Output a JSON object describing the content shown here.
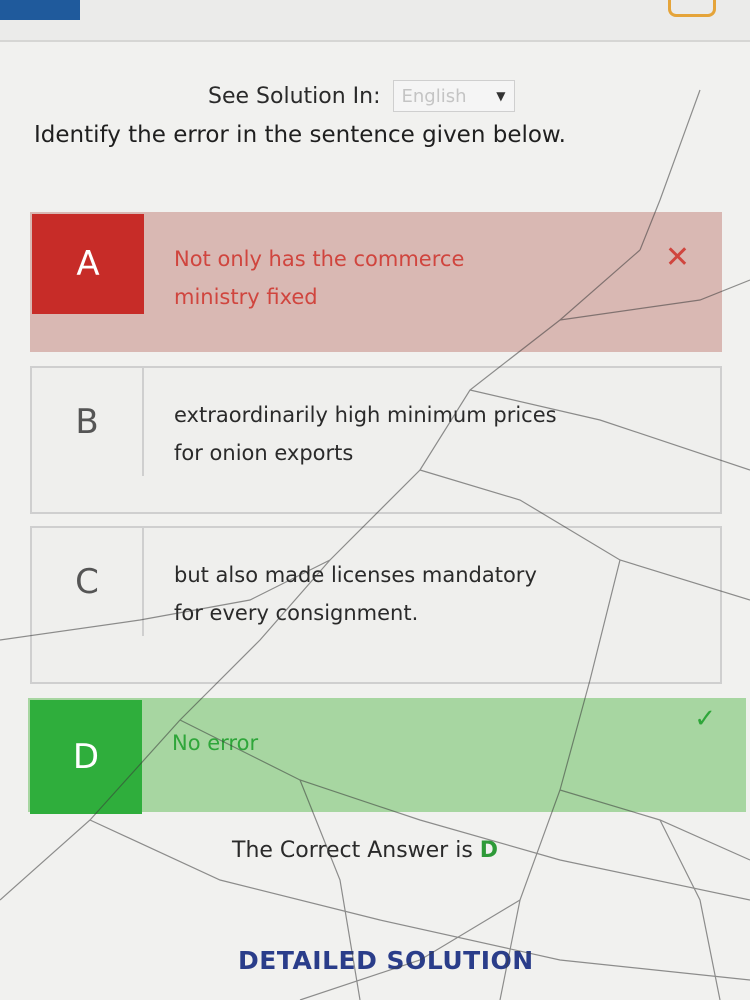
{
  "language": {
    "label": "See Solution In:",
    "selected": "English"
  },
  "question": {
    "text": "Identify the error in the sentence given below."
  },
  "options": [
    {
      "letter": "A",
      "line1": "Not only has the commerce",
      "line2": "ministry fixed",
      "state": "wrong"
    },
    {
      "letter": "B",
      "line1": "extraordinarily high minimum prices",
      "line2": "for onion exports",
      "state": "neutral"
    },
    {
      "letter": "C",
      "line1": "but also made licenses mandatory",
      "line2": "for every consignment.",
      "state": "neutral"
    },
    {
      "letter": "D",
      "line1": "No error",
      "line2": "",
      "state": "correct"
    }
  ],
  "result": {
    "prefix": "The Correct Answer is",
    "letter": "D"
  },
  "solution_button": {
    "label": "DETAILED SOLUTION"
  },
  "icons": {
    "wrong_mark": "cross-icon",
    "correct_mark": "check-icon",
    "dropdown": "chevron-down-icon"
  },
  "colors": {
    "wrong_accent": "#c72c28",
    "wrong_bg": "#d9b8b3",
    "correct_accent": "#2fae3c",
    "correct_bg": "#a7d6a1",
    "link": "#2a3d8a"
  }
}
